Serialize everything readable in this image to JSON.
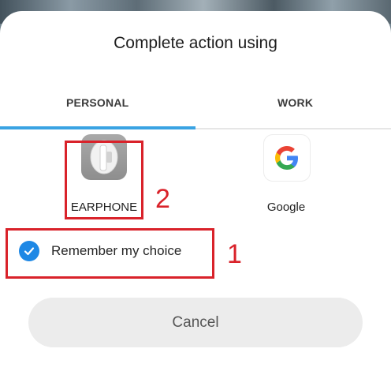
{
  "dialog": {
    "title": "Complete action using"
  },
  "tabs": [
    {
      "label": "PERSONAL",
      "selected": true
    },
    {
      "label": "WORK",
      "selected": false
    }
  ],
  "apps": [
    {
      "label": "EARPHONE",
      "icon": "earphone-app-icon"
    },
    {
      "label": "Google",
      "icon": "google-g-icon"
    }
  ],
  "remember": {
    "label": "Remember my choice",
    "checked": true
  },
  "cancel": {
    "label": "Cancel"
  },
  "annotations": {
    "marker_1": "1",
    "marker_2": "2",
    "color": "#d9222a"
  },
  "colors": {
    "accent": "#3aa3e3",
    "checkbox": "#1e88e5"
  }
}
